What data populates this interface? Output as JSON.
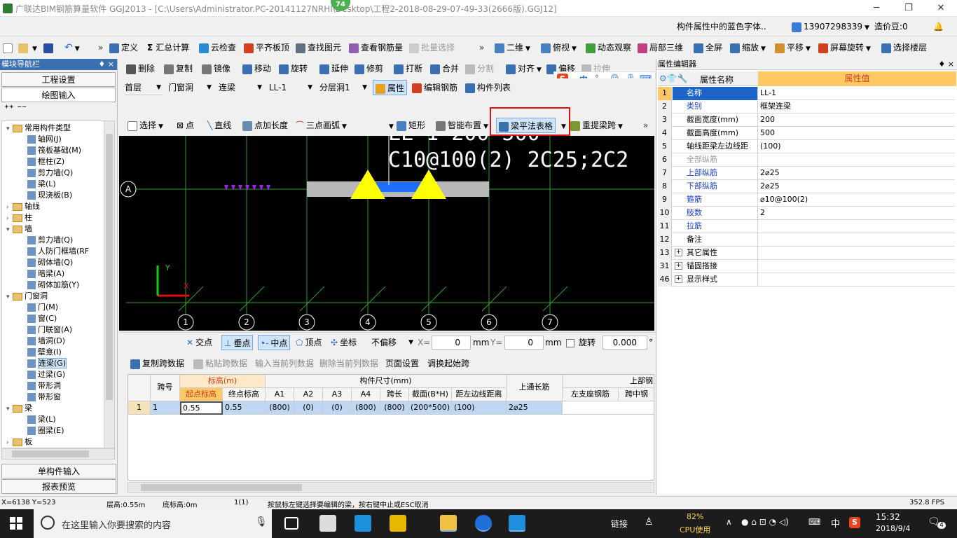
{
  "window": {
    "title": "广联达BIM钢筋算量软件 GGJ2013 - [C:\\Users\\Administrator.PC-20141127NRHI\\Desktop\\工程2-2018-08-29-07-49-33(2666版).GGJ12]",
    "badge": "74",
    "minimize": "─",
    "restore": "❐",
    "close": "✕"
  },
  "infobar": {
    "hint": "构件属性中的蓝色字体..",
    "phone": "13907298339",
    "bean": "造价豆:0",
    "bell": "🔔"
  },
  "toolbar1": {
    "define": "定义",
    "sum": "汇总计算",
    "cloud": "云检查",
    "flat": "平齐板顶",
    "find": "查找图元",
    "view_rebar": "查看钢筋量",
    "batch": "批量选择",
    "view2d": "二维",
    "top": "俯视",
    "dynamic": "动态观察",
    "local3d": "局部三维",
    "fullscreen": "全屏",
    "zoom": "缩放",
    "pan": "平移",
    "rotate_screen": "屏幕旋转",
    "select_floor": "选择楼层"
  },
  "toolbar2": {
    "delete": "删除",
    "copy": "复制",
    "mirror": "镜像",
    "move": "移动",
    "rotate": "旋转",
    "extend": "延伸",
    "trim": "修剪",
    "break": "打断",
    "merge": "合并",
    "split": "分割",
    "align": "对齐",
    "offset": "偏移",
    "stretch": "拉伸"
  },
  "toolbar3": {
    "floor": "首层",
    "category": "门窗洞",
    "type": "连梁",
    "element": "LL-1",
    "layer": "分层洞1",
    "property": "属性",
    "edit_rebar": "编辑钢筋",
    "list": "构件列表"
  },
  "toolbar4": {
    "select": "选择",
    "point": "点",
    "line": "直线",
    "point_len": "点加长度",
    "arc": "三点画弧",
    "rect": "矩形",
    "smart": "智能布置",
    "beam_table": "梁平法表格",
    "re_span": "重提梁跨"
  },
  "leftpanel": {
    "header": "模块导航栏",
    "pin": "♦ ×",
    "project_settings": "工程设置",
    "drawing_input": "绘图输入",
    "single_input": "单构件输入",
    "report": "报表预览",
    "tree": [
      {
        "label": "常用构件类型",
        "level": 0,
        "kind": "folder",
        "open": true
      },
      {
        "label": "轴网(J)",
        "level": 1,
        "kind": "item"
      },
      {
        "label": "筏板基础(M)",
        "level": 1,
        "kind": "item"
      },
      {
        "label": "框柱(Z)",
        "level": 1,
        "kind": "item"
      },
      {
        "label": "剪力墙(Q)",
        "level": 1,
        "kind": "item"
      },
      {
        "label": "梁(L)",
        "level": 1,
        "kind": "item"
      },
      {
        "label": "现浇板(B)",
        "level": 1,
        "kind": "item"
      },
      {
        "label": "轴线",
        "level": 0,
        "kind": "folder",
        "open": false
      },
      {
        "label": "柱",
        "level": 0,
        "kind": "folder",
        "open": false
      },
      {
        "label": "墙",
        "level": 0,
        "kind": "folder",
        "open": true
      },
      {
        "label": "剪力墙(Q)",
        "level": 1,
        "kind": "item"
      },
      {
        "label": "人防门框墙(RF",
        "level": 1,
        "kind": "item"
      },
      {
        "label": "砌体墙(Q)",
        "level": 1,
        "kind": "item"
      },
      {
        "label": "暗梁(A)",
        "level": 1,
        "kind": "item"
      },
      {
        "label": "砌体加筋(Y)",
        "level": 1,
        "kind": "item"
      },
      {
        "label": "门窗洞",
        "level": 0,
        "kind": "folder",
        "open": true
      },
      {
        "label": "门(M)",
        "level": 1,
        "kind": "item"
      },
      {
        "label": "窗(C)",
        "level": 1,
        "kind": "item"
      },
      {
        "label": "门联窗(A)",
        "level": 1,
        "kind": "item"
      },
      {
        "label": "墙洞(D)",
        "level": 1,
        "kind": "item"
      },
      {
        "label": "壁龛(I)",
        "level": 1,
        "kind": "item"
      },
      {
        "label": "连梁(G)",
        "level": 1,
        "kind": "item",
        "selected": true
      },
      {
        "label": "过梁(G)",
        "level": 1,
        "kind": "item"
      },
      {
        "label": "带形洞",
        "level": 1,
        "kind": "item"
      },
      {
        "label": "带形窗",
        "level": 1,
        "kind": "item"
      },
      {
        "label": "梁",
        "level": 0,
        "kind": "folder",
        "open": true
      },
      {
        "label": "梁(L)",
        "level": 1,
        "kind": "item"
      },
      {
        "label": "圈梁(E)",
        "level": 1,
        "kind": "item"
      },
      {
        "label": "板",
        "level": 0,
        "kind": "folder",
        "open": false
      }
    ]
  },
  "canvas": {
    "text_top": "LL-1 200*500",
    "text_main": "C10@100(2) 2C25;2C2",
    "axis_a": "A",
    "axes": [
      "1",
      "2",
      "3",
      "4",
      "5",
      "6",
      "7"
    ],
    "ucs_y": "Y",
    "ucs_x": "X"
  },
  "snapbar": {
    "intersect": "交点",
    "perp": "垂点",
    "mid": "中点",
    "vertex": "顶点",
    "coord": "坐标",
    "offset_mode": "不偏移",
    "x_label": "X=",
    "x_value": "0",
    "x_unit": "mm",
    "y_label": "Y=",
    "y_value": "0",
    "y_unit": "mm",
    "rotate": "旋转",
    "rotate_value": "0.000",
    "degree": "°"
  },
  "bottombar": {
    "copy_span": "复制跨数据",
    "paste_span": "粘贴跨数据",
    "input_col": "输入当前列数据",
    "delete_col": "删除当前列数据",
    "page_setup": "页面设置",
    "swap_start": "调换起始跨"
  },
  "grid": {
    "h_span": "跨号",
    "h_elev": "标高(m)",
    "h_start": "起点标高",
    "h_end": "终点标高",
    "h_dims": "构件尺寸(mm)",
    "h_a1": "A1",
    "h_a2": "A2",
    "h_a3": "A3",
    "h_a4": "A4",
    "h_len": "跨长",
    "h_section": "截面(B*H)",
    "h_dist": "距左边线距离",
    "h_top_long": "上通长筋",
    "h_top": "上部钢",
    "h_left_seat": "左支座钢筋",
    "h_mid": "跨中钢",
    "row": {
      "idx": "1",
      "span": "1",
      "start": "0.55",
      "end": "0.55",
      "a1": "(800)",
      "a2": "(0)",
      "a3": "(0)",
      "a4": "(800)",
      "len": "(800)",
      "section": "(200*500)",
      "dist": "(100)",
      "top_long": "2⌀25",
      "left_seat": "",
      "mid": ""
    }
  },
  "rightpanel": {
    "header": "属性编辑器",
    "col_name": "属性名称",
    "col_value": "属性值",
    "rows": [
      {
        "n": "1",
        "k": "名称",
        "v": "LL-1",
        "blue": true
      },
      {
        "n": "2",
        "k": "类别",
        "v": "框架连梁",
        "blue": true
      },
      {
        "n": "3",
        "k": "截面宽度(mm)",
        "v": "200",
        "blue": false
      },
      {
        "n": "4",
        "k": "截面高度(mm)",
        "v": "500",
        "blue": false
      },
      {
        "n": "5",
        "k": "轴线距梁左边线距",
        "v": "(100)",
        "blue": false
      },
      {
        "n": "6",
        "k": "全部纵筋",
        "v": "",
        "blue": false,
        "gray": true
      },
      {
        "n": "7",
        "k": "上部纵筋",
        "v": "2⌀25",
        "blue": true
      },
      {
        "n": "8",
        "k": "下部纵筋",
        "v": "2⌀25",
        "blue": true
      },
      {
        "n": "9",
        "k": "箍筋",
        "v": "⌀10@100(2)",
        "blue": true
      },
      {
        "n": "10",
        "k": "肢数",
        "v": "2",
        "blue": true
      },
      {
        "n": "11",
        "k": "拉筋",
        "v": "",
        "blue": true
      },
      {
        "n": "12",
        "k": "备注",
        "v": "",
        "blue": false
      },
      {
        "n": "13",
        "k": "其它属性",
        "v": "",
        "blue": false,
        "group": true
      },
      {
        "n": "31",
        "k": "锚固搭接",
        "v": "",
        "blue": false,
        "group": true
      },
      {
        "n": "46",
        "k": "显示样式",
        "v": "",
        "blue": false,
        "group": true
      }
    ]
  },
  "status": {
    "coords": "X=6138 Y=523",
    "floor_h": "层高:0.55m",
    "base_h": "底标高:0m",
    "count": "1(1)",
    "msg": "按鼠标左键选择要编辑的梁，按右键中止或ESC取消",
    "fps": "352.8 FPS"
  },
  "taskbar": {
    "search": "在这里输入你要搜索的内容",
    "link": "链接",
    "cpu_pct": "82%",
    "cpu_label": "CPU使用",
    "ime": "中",
    "time": "15:32",
    "date": "2018/9/4",
    "notify": "4"
  },
  "colors": {
    "highlight_box": "#e01010",
    "canvas_bg": "#000000",
    "grid_line": "#2ea02e",
    "red_line": "#d02020",
    "support": "#ffff00",
    "beam_blue": "#1e6fff",
    "selected_row": "#bfd7f2",
    "accent_orange": "#ffc864"
  }
}
